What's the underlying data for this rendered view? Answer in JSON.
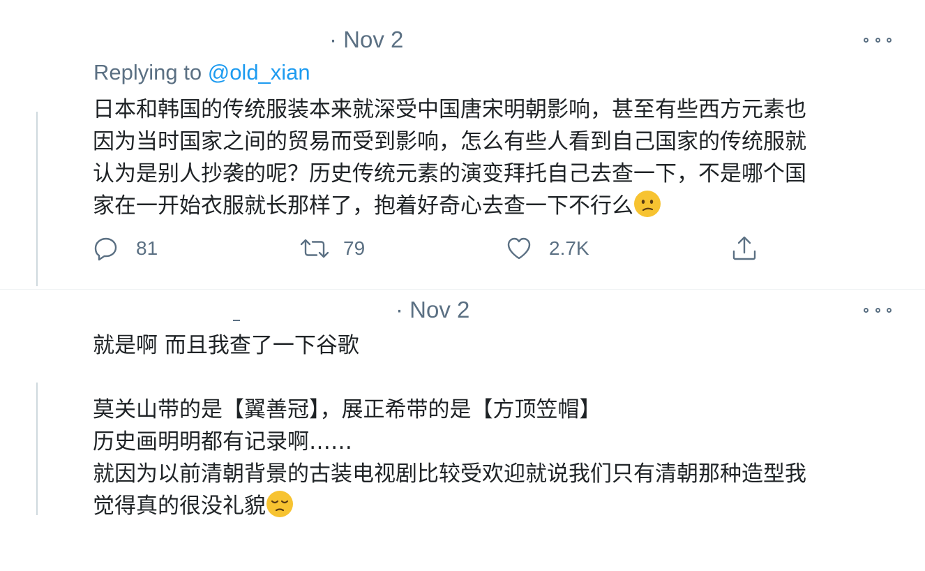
{
  "tweet1": {
    "date": "· Nov 2",
    "replying_prefix": "Replying to ",
    "replying_handle": "@old_xian",
    "text": "日本和韩国的传统服装本来就深受中国唐宋明朝影响，甚至有些西方元素也\n因为当时国家之间的贸易而受到影响，怎么有些人看到自己国家的传统服就\n认为是别人抄袭的呢？历史传统元素的演变拜托自己去查一下，不是哪个国\n家在一开始衣服就长那样了，抱着好奇心去查一下不行么",
    "emoji": "confused-face-emoji",
    "actions": {
      "reply_count": "81",
      "retweet_count": "79",
      "like_count": "2.7K"
    }
  },
  "tweet2": {
    "date": "· Nov 2",
    "text": "就是啊 而且我查了一下谷歌\n\n莫关山带的是【翼善冠】，展正希带的是【方顶笠帽】\n历史画明明都有记录啊……\n就因为以前清朝背景的古装电视剧比较受欢迎就说我们只有清朝那种造型我\n觉得真的很没礼貌",
    "emoji": "pensive-face-emoji"
  },
  "colors": {
    "text": "#1f2326",
    "secondary": "#5b7083",
    "link": "#1d9bf0",
    "thread_line": "#cfd9de",
    "emoji_yellow": "#f7c331"
  }
}
